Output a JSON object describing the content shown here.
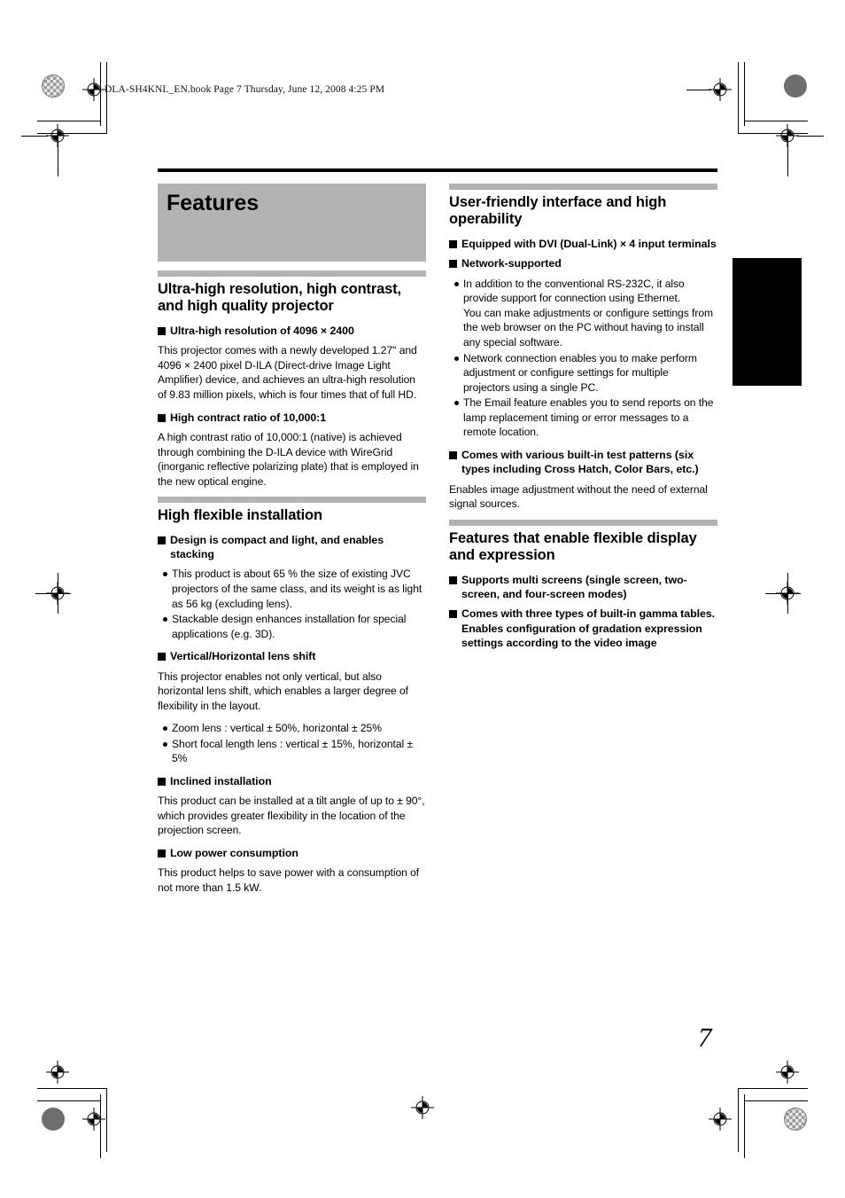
{
  "header": {
    "book_line": "DLA-SH4KNL_EN.book  Page 7  Thursday, June 12, 2008  4:25 PM"
  },
  "doc": {
    "title": "Features",
    "page_number": "7"
  },
  "colors": {
    "title_block_gray": "#b3b3b3",
    "section_bar_gray": "#b3b3b3",
    "rule_black": "#000000",
    "thumb_tab_black": "#000000"
  },
  "left_column": {
    "sections": [
      {
        "heading": "Ultra-high resolution, high contrast, and high quality projector",
        "blocks": [
          {
            "type": "square",
            "text": "Ultra-high resolution of 4096 × 2400"
          },
          {
            "type": "para",
            "text": "This projector comes with a newly developed 1.27\" and 4096 × 2400 pixel D-ILA (Direct-drive Image Light Amplifier) device, and achieves an ultra-high resolution of 9.83 million pixels, which is four times that of full HD."
          },
          {
            "type": "square",
            "text": "High contract ratio of 10,000:1"
          },
          {
            "type": "para",
            "text": "A high contrast ratio of 10,000:1 (native) is achieved through combining the D-ILA device with WireGrid (inorganic reflective polarizing plate) that is employed in the new optical engine."
          }
        ]
      },
      {
        "heading": "High flexible installation",
        "blocks": [
          {
            "type": "square",
            "text": "Design is compact and light, and enables stacking"
          },
          {
            "type": "dots",
            "items": [
              "This product is about 65 % the size of existing JVC projectors of the same class, and its weight is as light as 56 kg (excluding lens).",
              "Stackable design enhances installation for special applications (e.g. 3D)."
            ]
          },
          {
            "type": "square",
            "text": "Vertical/Horizontal lens shift"
          },
          {
            "type": "para",
            "text": "This projector enables not only vertical, but also horizontal lens shift, which enables a larger degree of flexibility in the layout."
          },
          {
            "type": "dots",
            "items": [
              "Zoom lens : vertical ± 50%, horizontal ± 25%",
              "Short focal length lens : vertical ± 15%, horizontal ± 5%"
            ]
          },
          {
            "type": "square",
            "text": "Inclined installation"
          },
          {
            "type": "para",
            "text": "This product can be installed at a tilt angle of up to ± 90°, which provides greater flexibility in the location of the projection screen."
          },
          {
            "type": "square",
            "text": "Low power consumption"
          },
          {
            "type": "para",
            "text": "This product helps to save power with a consumption of not more than 1.5 kW."
          }
        ]
      }
    ]
  },
  "right_column": {
    "sections": [
      {
        "heading": "User-friendly interface and high operability",
        "blocks": [
          {
            "type": "square",
            "text": "Equipped with DVI (Dual-Link) × 4 input terminals"
          },
          {
            "type": "square",
            "text": "Network-supported"
          },
          {
            "type": "dots",
            "items": [
              "In addition to the conventional RS-232C, it also provide support for connection using Ethernet.\nYou can make adjustments or configure settings from the web browser on the PC without having to install any special software.",
              "Network connection enables you to make perform adjustment or configure settings for multiple projectors using a single PC.",
              "The Email feature enables you to send reports on the lamp replacement timing or error messages to a remote location."
            ]
          },
          {
            "type": "square",
            "text": "Comes with various built-in test patterns (six types including Cross Hatch, Color Bars, etc.)"
          },
          {
            "type": "para",
            "text": "Enables image adjustment without the need of external signal sources."
          }
        ]
      },
      {
        "heading": "Features that enable flexible display and expression",
        "blocks": [
          {
            "type": "square",
            "text": "Supports multi screens (single screen, two-screen, and four-screen modes)"
          },
          {
            "type": "square",
            "text": "Comes with three types of built-in gamma tables. Enables configuration of gradation expression settings according to the video image"
          }
        ]
      }
    ]
  }
}
